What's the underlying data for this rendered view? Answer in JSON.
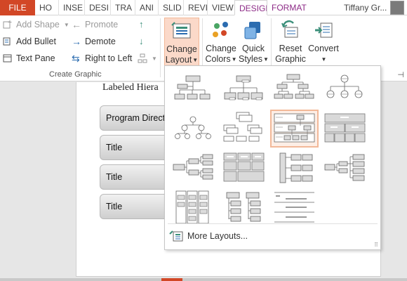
{
  "tabs": [
    "FILE",
    "HO",
    "INSE",
    "DESI",
    "TRA",
    "ANI",
    "SLID",
    "REVI",
    "VIEW",
    "DESIGN",
    "FORMAT"
  ],
  "user_name": "Tiffany Gr...",
  "ribbon": {
    "add_shape": "Add Shape",
    "add_bullet": "Add Bullet",
    "text_pane": "Text Pane",
    "promote": "Promote",
    "demote": "Demote",
    "right_to_left": "Right to Left",
    "group_label": "Create Graphic",
    "change_layout": [
      "Change",
      "Layout"
    ],
    "change_colors": [
      "Change",
      "Colors"
    ],
    "quick_styles": [
      "Quick",
      "Styles"
    ],
    "reset_graphic": [
      "Reset",
      "Graphic"
    ],
    "convert": [
      "Convert",
      ""
    ]
  },
  "slide": {
    "title": "Labeled Hiera",
    "shapes": [
      "Program Direct",
      "Title",
      "Title",
      "Title"
    ]
  },
  "dropdown": {
    "more_layouts": "More Layouts...",
    "selected_index": 6
  },
  "colors": {
    "file_tab": "#d24726",
    "contextual_tab": "#8c2a86",
    "selection_fill": "#fdeee6",
    "selection_border": "#f2b898",
    "icon_green": "#3b8f7a",
    "icon_blue": "#2b6cb0"
  }
}
